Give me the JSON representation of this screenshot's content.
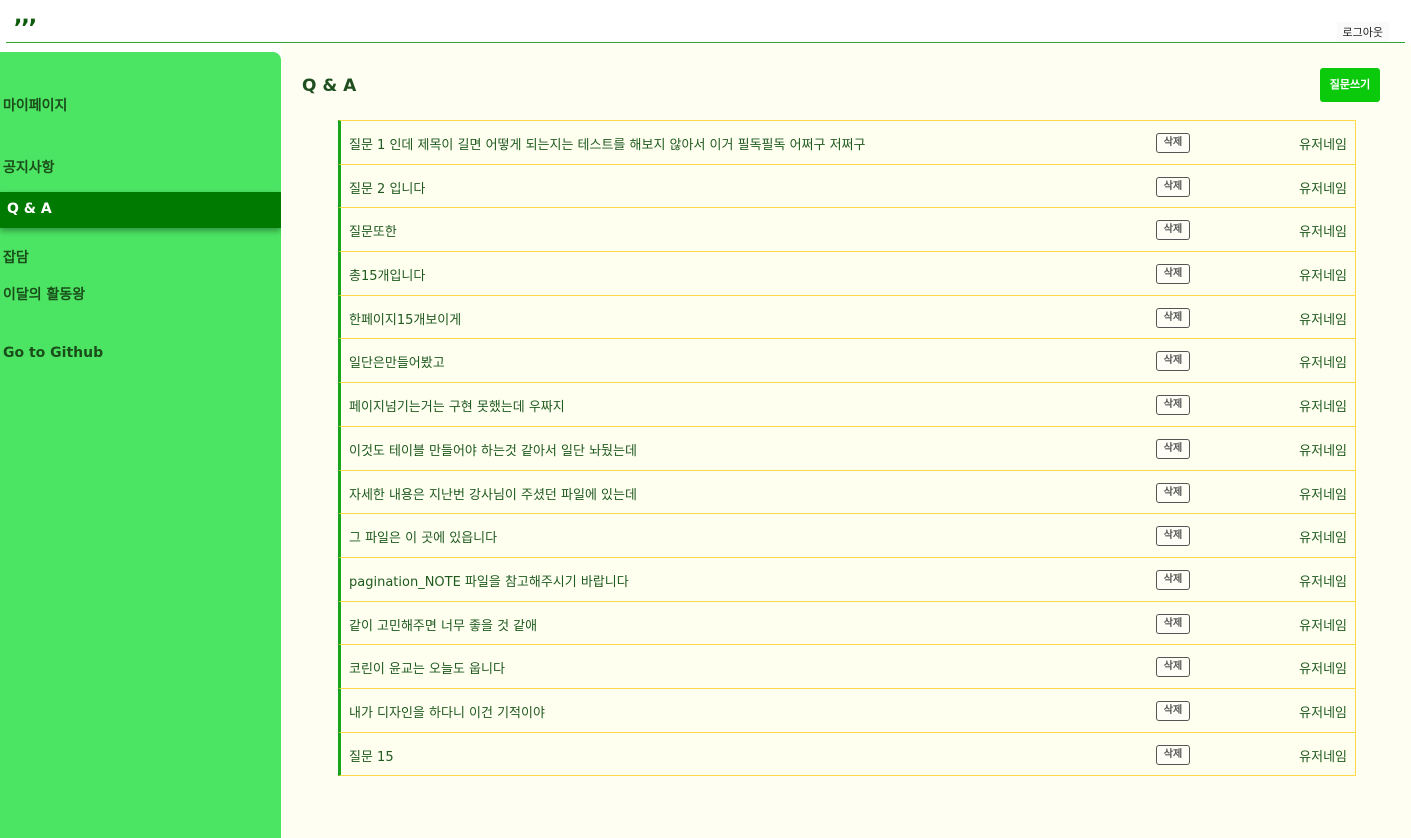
{
  "header": {
    "logo": ",,,",
    "logout_label": "로그아웃"
  },
  "sidebar": {
    "items": [
      {
        "label": "마이페이지"
      },
      {
        "label": "공지사항"
      },
      {
        "label": "Q & A",
        "active": true
      },
      {
        "label": "잡담"
      },
      {
        "label": "이달의 활동왕"
      },
      {
        "label": "Go to Github"
      }
    ]
  },
  "main": {
    "title": "Q & A",
    "write_label": "질문쓰기",
    "delete_label": "삭제",
    "posts": [
      {
        "title": "질문 1 인데 제목이 길면 어떻게 되는지는 테스트를 해보지 않아서 이거 필독필독 어쩌구 저쩌구",
        "author": "유저네임"
      },
      {
        "title": "질문 2 입니다",
        "author": "유저네임"
      },
      {
        "title": "질문또한",
        "author": "유저네임"
      },
      {
        "title": "총15개입니다",
        "author": "유저네임"
      },
      {
        "title": "한페이지15개보이게",
        "author": "유저네임"
      },
      {
        "title": "일단은만들어봤고",
        "author": "유저네임"
      },
      {
        "title": "페이지넘기는거는 구현 못했는데 우짜지",
        "author": "유저네임"
      },
      {
        "title": "이것도 테이블 만들어야 하는것 같아서 일단 놔뒀는데",
        "author": "유저네임"
      },
      {
        "title": "자세한 내용은 지난번 강사님이 주셨던 파일에 있는데",
        "author": "유저네임"
      },
      {
        "title": "그 파일은 이 곳에 있읍니다",
        "author": "유저네임"
      },
      {
        "title": "pagination_NOTE 파일을 참고해주시기 바랍니다",
        "author": "유저네임"
      },
      {
        "title": "같이 고민해주면 너무 좋을 것 같애",
        "author": "유저네임"
      },
      {
        "title": "코린이 윤교는 오늘도 웁니다",
        "author": "유저네임"
      },
      {
        "title": "내가 디자인을 하다니 이건 기적이야",
        "author": "유저네임"
      },
      {
        "title": "질문 15",
        "author": "유저네임"
      }
    ]
  },
  "colors": {
    "sidebar_bg": "#4ce563",
    "sidebar_active": "#007a00",
    "main_bg": "#fefff2",
    "row_border": "#ffd84a",
    "row_accent": "#19a519",
    "write_button": "#0bc90b"
  }
}
